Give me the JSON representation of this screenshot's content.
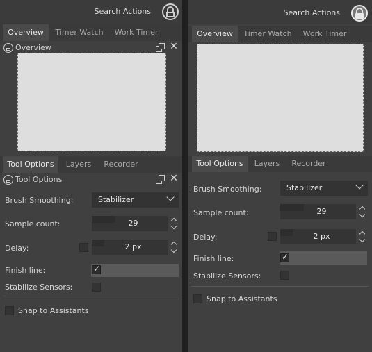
{
  "search_actions": "Search Actions",
  "top_tabs": [
    "Overview",
    "Timer Watch",
    "Work Timer"
  ],
  "overview_title": "Overview",
  "bottom_tabs": [
    "Tool Options",
    "Layers",
    "Recorder"
  ],
  "tool_options_title": "Tool Options",
  "brush_smoothing_label": "Brush Smoothing:",
  "brush_smoothing_value": "Stabilizer",
  "sample_count_label": "Sample count:",
  "sample_count_value": "29",
  "delay_label": "Delay:",
  "delay_value": "2 px",
  "finish_line_label": "Finish line:",
  "finish_line_checked": true,
  "stabilize_sensors_label": "Stabilize Sensors:",
  "stabilize_sensors_checked": false,
  "snap_label": "Snap to Assistants",
  "snap_checked": false,
  "icons": [
    "lock-icon",
    "float-icon",
    "close-icon",
    "chevron-down-icon",
    "spin-up-icon",
    "spin-down-icon",
    "checkmark-icon"
  ]
}
